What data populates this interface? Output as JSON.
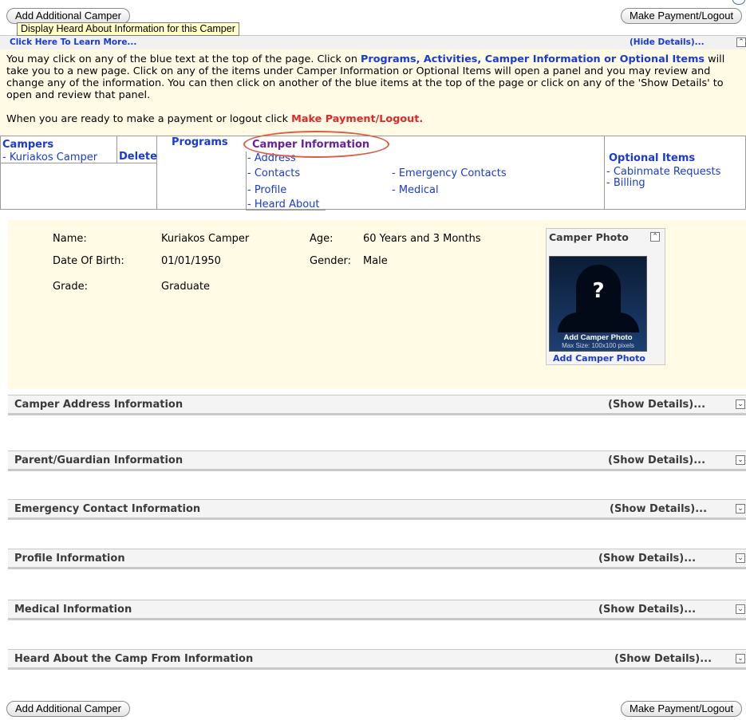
{
  "buttons": {
    "add_camper": "Add Additional Camper",
    "make_payment": "Make Payment/Logout"
  },
  "tooltip": "Display Heard About Information for this Camper",
  "topbar": {
    "learn_more": "Click Here To Learn More...",
    "hide_details": "(Hide Details)...",
    "collapse_icon": "double-chevron-up"
  },
  "info": {
    "p1_a": "You may click on any of the blue text at the top of the page. Click on ",
    "p1_link": "Programs, Activities, Camper Information or Optional Items",
    "p1_b": " will take you to a new page. Click on any of the items under Camper Information or Optional Items will open a panel and you may review and change any of the information. You can then click on another of the blue items at the top of the page or click on any of the 'Show Details' to open and review that panel.",
    "p2_a": "When you are ready to make a payment or logout click ",
    "p2_link": "Make Payment/Logout."
  },
  "nav": {
    "campers_header": "Campers",
    "camper_name": "- Kuriakos Camper",
    "delete": "Delete",
    "programs": "Programs",
    "camper_info_header": "Camper Information",
    "camper_info_items": [
      "- Address",
      "- Contacts",
      "- Emergency Contacts",
      "- Profile",
      "- Medical",
      "- Heard About"
    ],
    "optional_header": "Optional Items",
    "optional_items": [
      "- Cabinmate Requests",
      "- Billing"
    ]
  },
  "camper": {
    "name_label": "Name:",
    "name": "Kuriakos Camper",
    "age_label": "Age:",
    "age": "60 Years and 3 Months",
    "dob_label": "Date Of Birth:",
    "dob": "01/01/1950",
    "gender_label": "Gender:",
    "gender": "Male",
    "grade_label": "Grade:",
    "grade": "Graduate",
    "photo_title": "Camper Photo",
    "photo_caption": "Add Camper Photo",
    "photo_max": "Max Size: 100x100 pixels",
    "photo_link": "Add Camper Photo"
  },
  "sections": [
    {
      "title": "Camper Address Information",
      "action": "(Show Details)..."
    },
    {
      "title": "Parent/Guardian Information",
      "action": "(Show Details)..."
    },
    {
      "title": "Emergency Contact Information",
      "action": "(Show Details)..."
    },
    {
      "title": "Profile Information",
      "action": "(Show Details)..."
    },
    {
      "title": "Medical Information",
      "action": "(Show Details)..."
    },
    {
      "title": "Heard About the Camp From Information",
      "action": "(Show Details)..."
    }
  ],
  "colors": {
    "link_blue": "#1a3ad4",
    "accent_red": "#e0282a",
    "panel_yellow": "#fffbe5",
    "camper_info_purple": "#6a1fa0"
  }
}
